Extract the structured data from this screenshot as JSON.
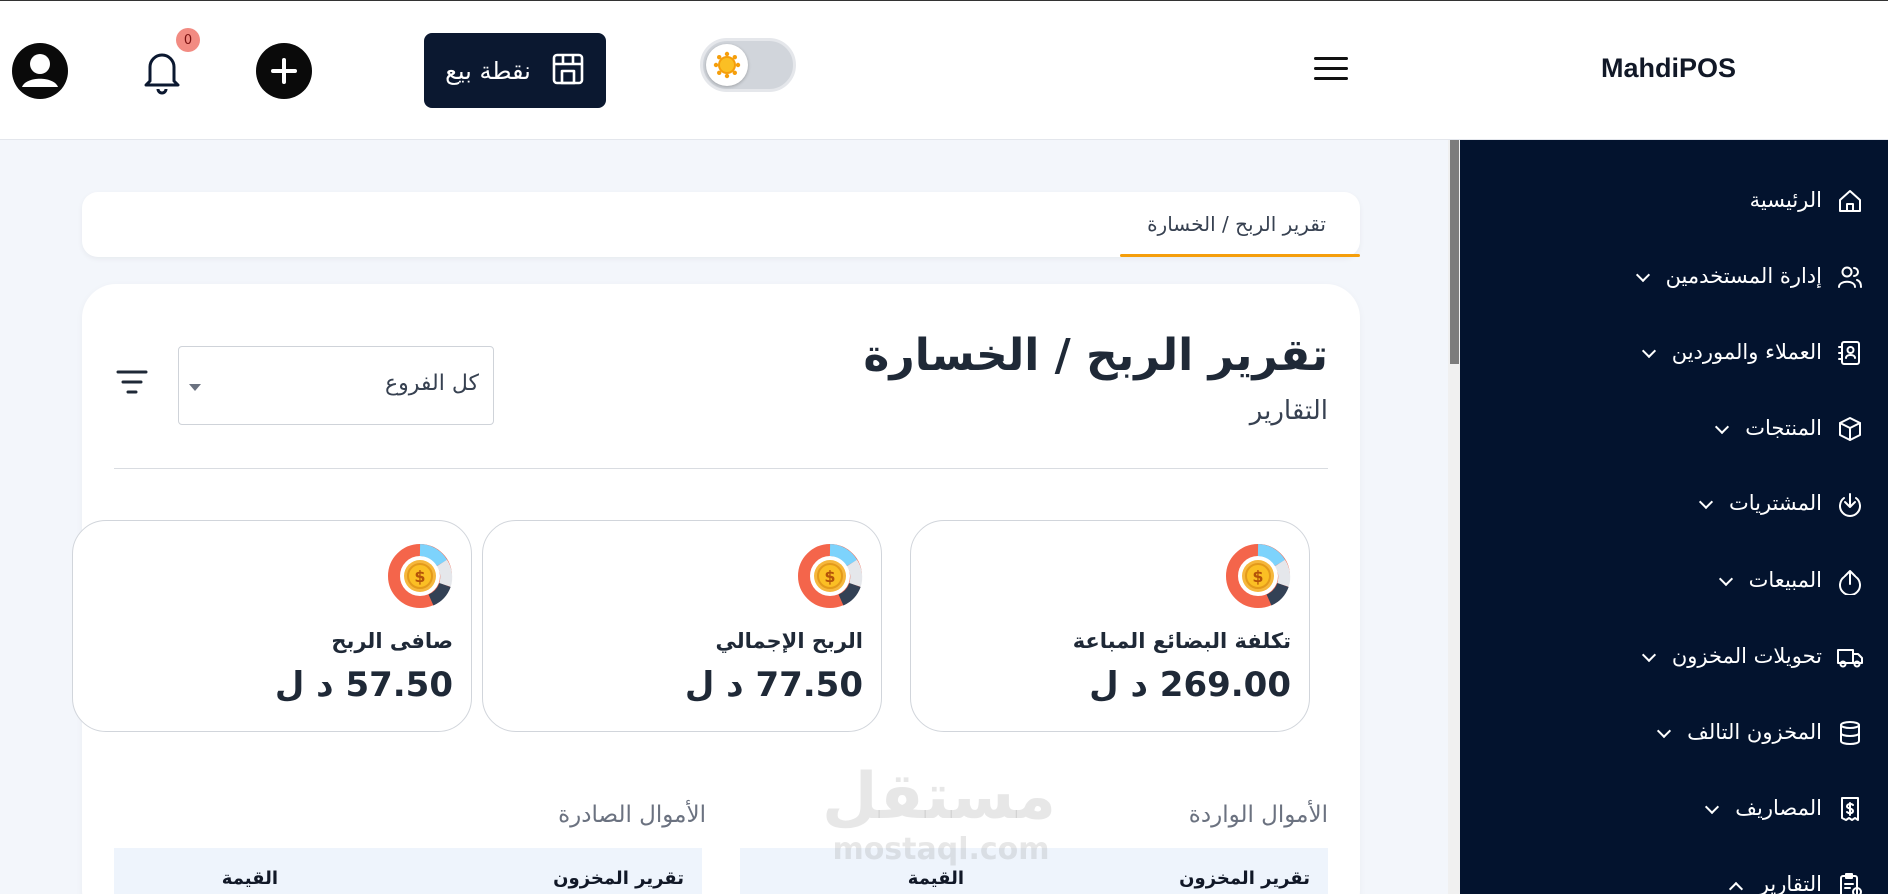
{
  "header": {
    "brand": "MahdiPOS",
    "pos_button_label": "نقطة بيع",
    "notification_count": "0"
  },
  "sidebar": {
    "items": [
      {
        "label": "الرئيسية",
        "icon": "home-icon",
        "expandable": false
      },
      {
        "label": "إدارة المستخدمين",
        "icon": "users-icon",
        "expandable": true
      },
      {
        "label": "العملاء والموردين",
        "icon": "contacts-icon",
        "expandable": true
      },
      {
        "label": "المنتجات",
        "icon": "box-icon",
        "expandable": true
      },
      {
        "label": "المشتريات",
        "icon": "download-icon",
        "expandable": true
      },
      {
        "label": "المبيعات",
        "icon": "upload-icon",
        "expandable": true
      },
      {
        "label": "تحويلات المخزون",
        "icon": "truck-icon",
        "expandable": true
      },
      {
        "label": "المخزون التالف",
        "icon": "database-icon",
        "expandable": true
      },
      {
        "label": "المصاريف",
        "icon": "receipt-icon",
        "expandable": true
      },
      {
        "label": "التقارير",
        "icon": "report-icon",
        "expandable": true,
        "expanded": true
      }
    ]
  },
  "breadcrumb": "تقرير الربح / الخسارة",
  "main": {
    "title": "تقرير الربح / الخسارة",
    "subtitle": "التقارير",
    "branch_select_value": "كل الفروع",
    "stats": [
      {
        "label": "تكلفة البضائع المباعة",
        "value": "269.00 د ل"
      },
      {
        "label": "الربح الإجمالي",
        "value": "77.50 د ل"
      },
      {
        "label": "صافى الربح",
        "value": "57.50 د ل"
      }
    ],
    "incoming": {
      "title": "الأموال الواردة",
      "col1": "تقرير المخزون",
      "col2": "القيمة"
    },
    "outgoing": {
      "title": "الأموال الصادرة",
      "col1": "تقرير المخزون",
      "col2": "القيمة"
    }
  },
  "watermark": {
    "line1": "مستقل",
    "line2": "mostaql.com"
  },
  "colors": {
    "sidebar_bg": "#03132e",
    "accent": "#f59e0b",
    "pos_button_bg": "#0b1830"
  }
}
